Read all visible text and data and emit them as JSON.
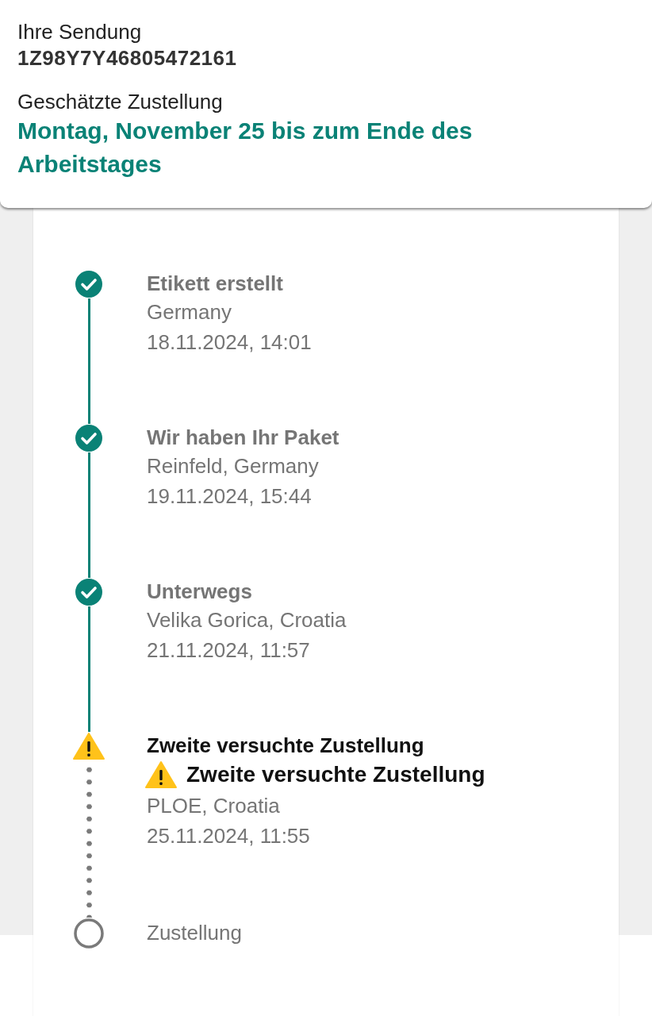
{
  "header": {
    "shipment_label": "Ihre Sendung",
    "tracking_number": "1Z98Y7Y46805472161",
    "estimate_label": "Geschätzte Zustellung",
    "estimate_value": "Montag, November 25 bis zum Ende des Arbeitstages"
  },
  "steps": [
    {
      "kind": "done",
      "title": "Etikett erstellt",
      "location": "Germany",
      "time": "18.11.2024, 14:01"
    },
    {
      "kind": "done",
      "title": "Wir haben Ihr Paket",
      "location": "Reinfeld, Germany",
      "time": "19.11.2024, 15:44"
    },
    {
      "kind": "done",
      "title": "Unterwegs",
      "location": "Velika Gorica, Croatia",
      "time": "21.11.2024, 11:57"
    },
    {
      "kind": "warning",
      "title": "Zweite versuchte Zustellung",
      "alert": "Zweite versuchte Zustellung",
      "location": "PLOE, Croatia",
      "time": "25.11.2024, 11:55"
    },
    {
      "kind": "pending",
      "title": "Zustellung"
    }
  ]
}
